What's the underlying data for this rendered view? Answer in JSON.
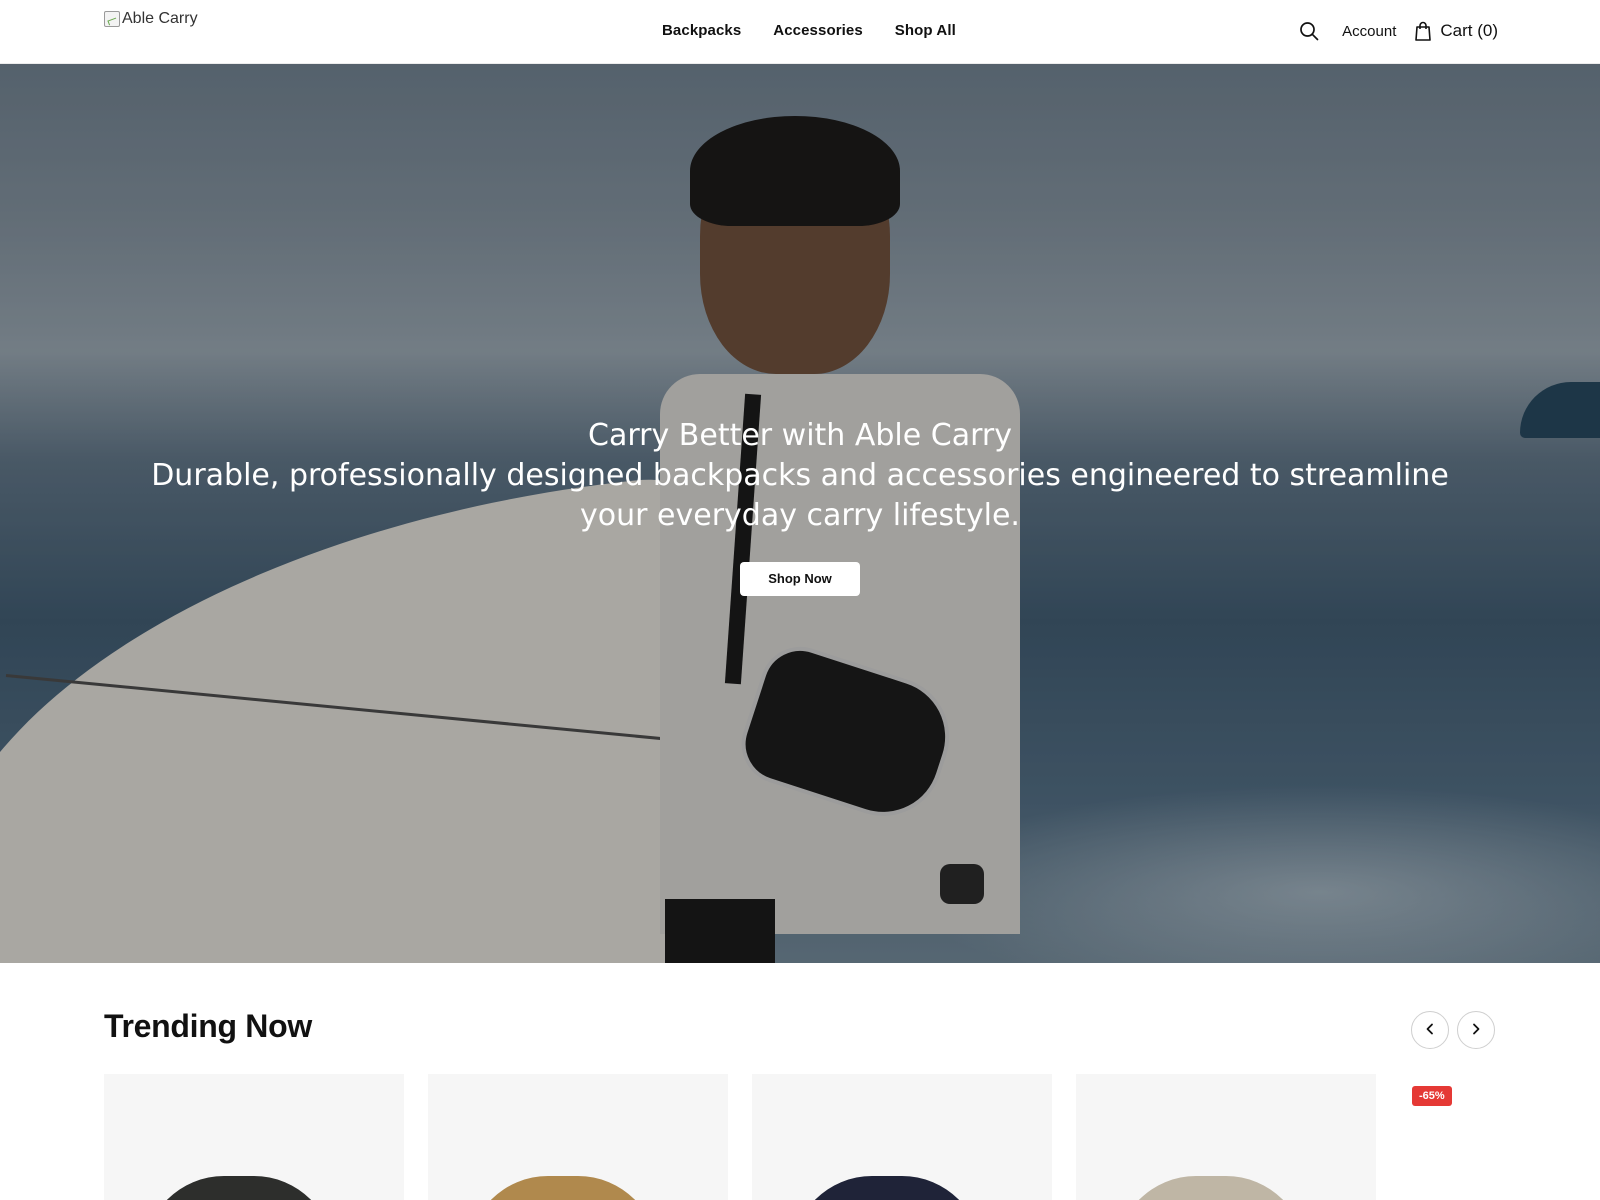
{
  "header": {
    "logo_alt": "Able Carry",
    "nav": [
      "Backpacks",
      "Accessories",
      "Shop All"
    ],
    "account_label": "Account",
    "cart_label": "Cart (0)"
  },
  "hero": {
    "title": "Carry Better with Able Carry",
    "subtitle": "Durable, professionally designed backpacks and accessories engineered to streamline your everyday carry lifestyle.",
    "cta_label": "Shop Now"
  },
  "trending": {
    "title": "Trending Now",
    "badges": [
      "-65%"
    ]
  },
  "colors": {
    "accent": "#111111",
    "sale": "#e53935"
  }
}
